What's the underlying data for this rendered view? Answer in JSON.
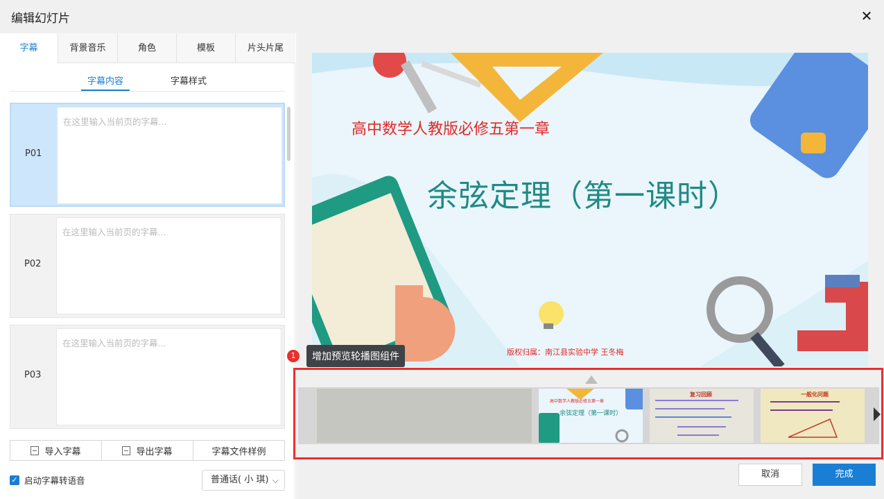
{
  "window": {
    "title": "编辑幻灯片"
  },
  "tabs": [
    {
      "label": "字幕"
    },
    {
      "label": "背景音乐"
    },
    {
      "label": "角色"
    },
    {
      "label": "模板"
    },
    {
      "label": "片头片尾"
    }
  ],
  "subtabs": [
    {
      "label": "字幕内容"
    },
    {
      "label": "字幕样式"
    }
  ],
  "slides": [
    {
      "label": "P01",
      "placeholder": "在这里输入当前页的字幕..."
    },
    {
      "label": "P02",
      "placeholder": "在这里输入当前页的字幕..."
    },
    {
      "label": "P03",
      "placeholder": "在这里输入当前页的字幕..."
    }
  ],
  "actions": {
    "import": "导入字幕",
    "export": "导出字幕",
    "sample": "字幕文件样例"
  },
  "tts": {
    "label": "启动字幕转语音",
    "voice": "普通话( 小 琪)"
  },
  "preview": {
    "subtitle": "高中数学人教版必修五第一章",
    "title": "余弦定理（第一课时）",
    "copyright": "版权归属：南江县实验中学   王冬梅"
  },
  "tooltip": {
    "badge": "1",
    "text": "增加预览轮播图组件"
  },
  "thumbs": [
    {
      "line1": "高中数学人教版必修五第一章",
      "line2": "余弦定理（第一课时）"
    },
    {
      "line1": "复习回顾"
    },
    {
      "line1": "一般化问题"
    }
  ],
  "footer": {
    "cancel": "取消",
    "done": "完成"
  },
  "colors": {
    "accent": "#1a7fd4",
    "highlight": "#e8302f",
    "title_teal": "#1f8a86"
  }
}
